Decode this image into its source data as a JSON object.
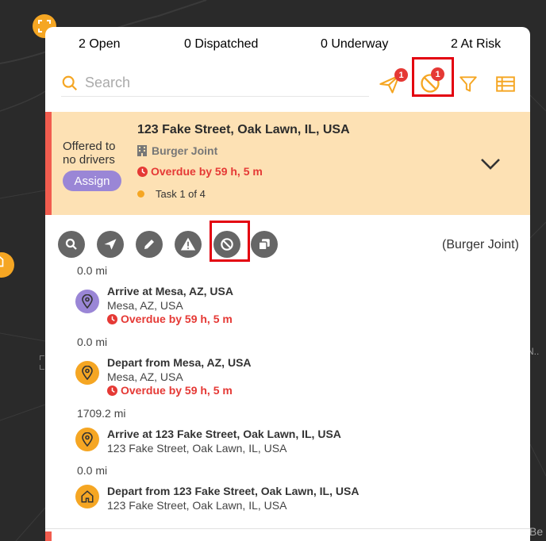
{
  "stats": {
    "open": "2 Open",
    "dispatched": "0 Dispatched",
    "underway": "0 Underway",
    "at_risk": "2 At Risk"
  },
  "search": {
    "placeholder": "Search"
  },
  "toolbar": {
    "dispatch_badge": "1",
    "blocked_badge": "1",
    "icons": [
      "paper-plane-icon",
      "blocked-icon",
      "filter-icon",
      "table-icon"
    ]
  },
  "task": {
    "status_line1": "Offered to",
    "status_line2": "no drivers",
    "assign_label": "Assign",
    "address": "123 Fake Street, Oak Lawn, IL, USA",
    "merchant": "Burger Joint",
    "overdue": "Overdue by 59 h, 5 m",
    "task_count": "Task 1 of 4"
  },
  "actions": {
    "icons": [
      "search-icon",
      "send-icon",
      "edit-icon",
      "warning-icon",
      "block-icon",
      "copy-icon"
    ],
    "merchant_label": "(Burger Joint)"
  },
  "route": {
    "distances": [
      "0.0 mi",
      "0.0 mi",
      "1709.2 mi",
      "0.0 mi"
    ],
    "stops": [
      {
        "title": "Arrive at Mesa, AZ, USA",
        "subtitle": "Mesa, AZ, USA",
        "overdue": "Overdue by 59 h, 5 m",
        "icon": "pin-icon",
        "color": "#9a86d6"
      },
      {
        "title": "Depart from Mesa, AZ, USA",
        "subtitle": "Mesa, AZ, USA",
        "overdue": "Overdue by 59 h, 5 m",
        "icon": "pin-icon",
        "color": "#f5a623"
      },
      {
        "title": "Arrive at 123 Fake Street, Oak Lawn, IL, USA",
        "subtitle": "123 Fake Street, Oak Lawn, IL, USA",
        "icon": "pin-icon",
        "color": "#f5a623"
      },
      {
        "title": "Depart from 123 Fake Street, Oak Lawn, IL, USA",
        "subtitle": "123 Fake Street, Oak Lawn, IL, USA",
        "icon": "home-icon",
        "color": "#f5a623"
      }
    ]
  },
  "map": {
    "label_right": "N..",
    "label_bottom": "Be"
  },
  "colors": {
    "accent": "#f5a623",
    "danger": "#e53935",
    "purple": "#9a86d6",
    "card_bg": "#fde1b4"
  }
}
